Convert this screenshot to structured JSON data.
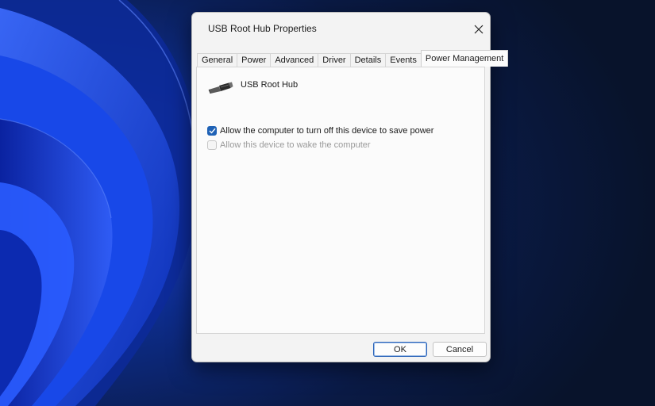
{
  "dialog": {
    "title": "USB Root Hub Properties",
    "close_icon": "close-icon"
  },
  "tabs": [
    {
      "label": "General",
      "active": false
    },
    {
      "label": "Power",
      "active": false
    },
    {
      "label": "Advanced",
      "active": false
    },
    {
      "label": "Driver",
      "active": false
    },
    {
      "label": "Details",
      "active": false
    },
    {
      "label": "Events",
      "active": false
    },
    {
      "label": "Power Management",
      "active": true
    }
  ],
  "device": {
    "icon": "usb-plug-icon",
    "name": "USB Root Hub"
  },
  "options": [
    {
      "label": "Allow the computer to turn off this device to save power",
      "checked": true,
      "enabled": true
    },
    {
      "label": "Allow this device to wake the computer",
      "checked": false,
      "enabled": false
    }
  ],
  "buttons": {
    "ok_label": "OK",
    "cancel_label": "Cancel"
  },
  "colors": {
    "accent": "#1f62b6",
    "wallpaper": "#0a1630"
  }
}
